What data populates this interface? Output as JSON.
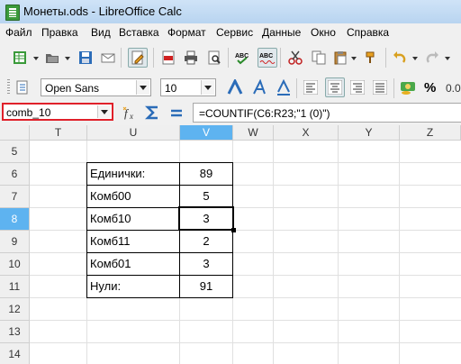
{
  "window": {
    "title": "Монеты.ods - LibreOffice Calc"
  },
  "menu": [
    "Файл",
    "Правка",
    "Вид",
    "Вставка",
    "Формат",
    "Сервис",
    "Данные",
    "Окно",
    "Справка"
  ],
  "format": {
    "font_name": "Open Sans",
    "font_size": "10"
  },
  "formula": {
    "name_box": "comb_10",
    "content": "=COUNTIF(C6:R23;\"1 (0)\")"
  },
  "columns": [
    "T",
    "U",
    "V",
    "W",
    "X",
    "Y",
    "Z"
  ],
  "selected_column": "V",
  "rows": [
    "5",
    "6",
    "7",
    "8",
    "9",
    "10",
    "11",
    "12",
    "13",
    "14"
  ],
  "selected_row": "8",
  "table": [
    {
      "label": "Единички:",
      "value": "89"
    },
    {
      "label": "Комб00",
      "value": "5"
    },
    {
      "label": "Комб10",
      "value": "3"
    },
    {
      "label": "Комб11",
      "value": "2"
    },
    {
      "label": "Комб01",
      "value": "3"
    },
    {
      "label": "Нули:",
      "value": "91"
    }
  ],
  "colors": {
    "selection": "#5eb3f0",
    "namebox_border": "#e0202a"
  }
}
